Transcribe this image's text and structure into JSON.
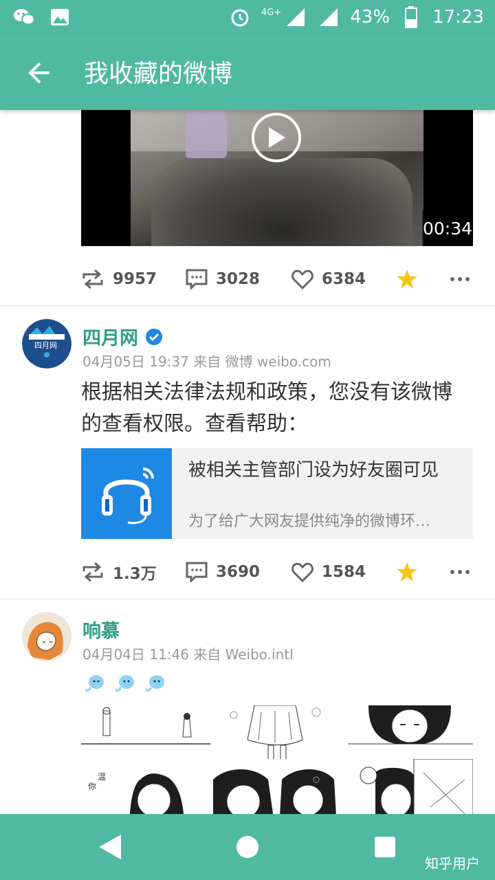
{
  "status_bar": {
    "network": "4G+",
    "battery": "43%",
    "time": "17:23"
  },
  "app_bar": {
    "title": "我收藏的微博"
  },
  "post1": {
    "video_duration": "00:34",
    "repost_count": "9957",
    "comment_count": "3028",
    "like_count": "6384"
  },
  "post2": {
    "author": "四月网",
    "avatar_text": "四月网",
    "meta": "04月05日 19:37 来自 微博 weibo.com",
    "text": "根据相关法律法规和政策，您没有该微博的查看权限。查看帮助：",
    "link_title": "被相关主管部门设为好友圈可见",
    "link_desc": "为了给广大网友提供纯净的微博环…",
    "repost_count": "1.3万",
    "comment_count": "3690",
    "like_count": "1584"
  },
  "post3": {
    "author": "响慕",
    "meta": "04月04日 11:46 来自 Weibo.intl"
  },
  "watermark": "知乎用户",
  "colors": {
    "accent": "#4fb9a1",
    "author": "#2f9d85",
    "star": "#f5c518",
    "verified": "#1e88e5"
  }
}
